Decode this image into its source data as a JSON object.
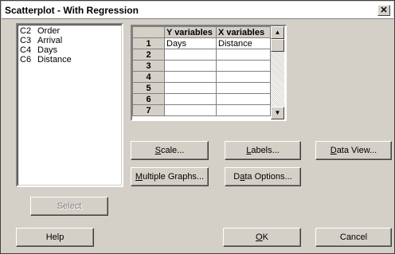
{
  "window": {
    "title": "Scatterplot - With Regression",
    "close_glyph": "✕"
  },
  "variables": [
    {
      "col": "C2",
      "name": "Order"
    },
    {
      "col": "C3",
      "name": "Arrival"
    },
    {
      "col": "C4",
      "name": "Days"
    },
    {
      "col": "C6",
      "name": "Distance"
    }
  ],
  "grid": {
    "headers": [
      "Y variables",
      "X variables"
    ],
    "rows": [
      {
        "num": "1",
        "y": "Days",
        "x": "Distance"
      },
      {
        "num": "2",
        "y": "",
        "x": ""
      },
      {
        "num": "3",
        "y": "",
        "x": ""
      },
      {
        "num": "4",
        "y": "",
        "x": ""
      },
      {
        "num": "5",
        "y": "",
        "x": ""
      },
      {
        "num": "6",
        "y": "",
        "x": ""
      },
      {
        "num": "7",
        "y": "",
        "x": ""
      }
    ]
  },
  "buttons": {
    "scale": {
      "u": "S",
      "rest": "cale..."
    },
    "labels": {
      "u": "L",
      "rest": "abels..."
    },
    "data_view": {
      "u": "D",
      "rest": "ata View..."
    },
    "multiple_graphs": {
      "u": "M",
      "rest": "ultiple Graphs..."
    },
    "data_options": {
      "pre": "D",
      "u": "a",
      "rest": "ta Options..."
    },
    "select": "Select",
    "help": "Help",
    "ok": {
      "u": "O",
      "rest": "K"
    },
    "cancel": "Cancel"
  },
  "scroll_icons": {
    "up": "▲",
    "down": "▼"
  }
}
